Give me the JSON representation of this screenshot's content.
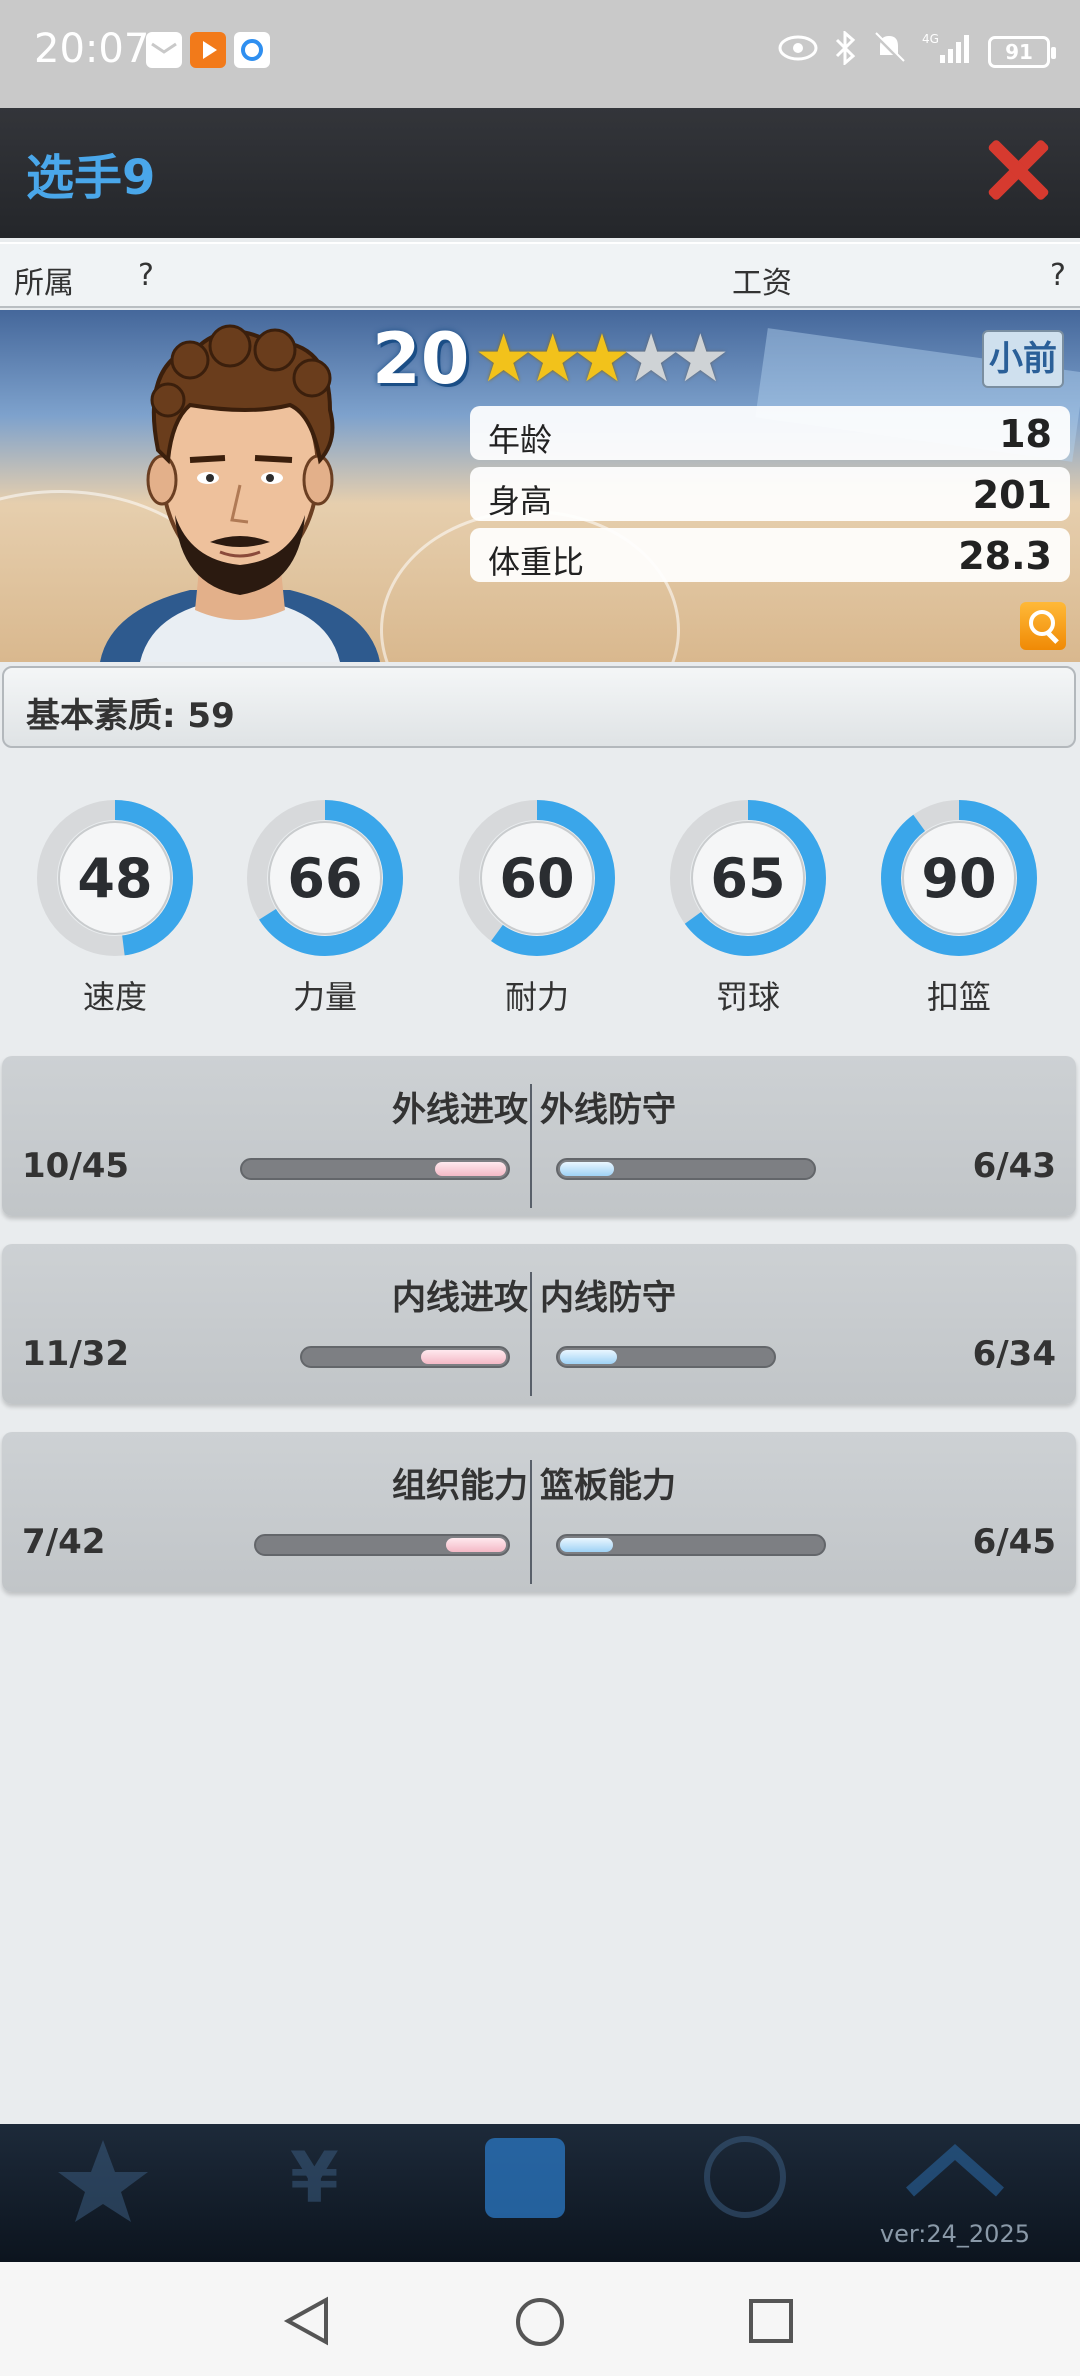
{
  "status_bar": {
    "time": "20:07",
    "notif_icons": [
      "mail-icon",
      "video-app-icon",
      "browser-app-icon"
    ],
    "right_icons": [
      "eye-icon",
      "bluetooth-icon",
      "bell-off-icon",
      "signal-4g-icon"
    ],
    "battery": "91"
  },
  "header": {
    "title": "选手9"
  },
  "affiliation": {
    "team_label": "所属",
    "team_value": "?",
    "salary_label": "工资",
    "salary_value": "?"
  },
  "player": {
    "level": "20",
    "stars_on": 3,
    "stars_total": 5,
    "position": "小前",
    "attributes": [
      {
        "label": "年龄",
        "value": "18"
      },
      {
        "label": "身高",
        "value": "201"
      },
      {
        "label": "体重比",
        "value": "28.3"
      }
    ]
  },
  "base_quality": "基本素质: 59",
  "rings": [
    {
      "label": "速度",
      "value": "48",
      "fraction": 0.48
    },
    {
      "label": "力量",
      "value": "66",
      "fraction": 0.66
    },
    {
      "label": "耐力",
      "value": "60",
      "fraction": 0.6
    },
    {
      "label": "罚球",
      "value": "65",
      "fraction": 0.65
    },
    {
      "label": "扣篮",
      "value": "90",
      "fraction": 0.9
    }
  ],
  "skills": [
    {
      "left_name": "外线进攻",
      "left_value": "10/45",
      "left_fraction": 0.222,
      "right_name": "外线防守",
      "right_value": "6/43",
      "right_fraction": 0.14
    },
    {
      "left_name": "内线进攻",
      "left_value": "11/32",
      "left_fraction": 0.344,
      "right_name": "内线防守",
      "right_value": "6/34",
      "right_fraction": 0.176
    },
    {
      "left_name": "组织能力",
      "left_value": "7/42",
      "left_fraction": 0.167,
      "right_name": "篮板能力",
      "right_value": "6/45",
      "right_fraction": 0.133
    }
  ],
  "game_nav": {
    "items": [
      {
        "icon": "star-icon"
      },
      {
        "icon": "yen-icon"
      },
      {
        "icon": "team-icon"
      },
      {
        "icon": "ball-icon"
      },
      {
        "icon": "chevron-up-icon"
      }
    ],
    "version": "ver:24_2025"
  },
  "colors": {
    "ring_fill": "#3aa6ea",
    "ring_track": "#d7d9db",
    "title_blue": "#4aa7ea",
    "close_red": "#d63a2f"
  }
}
